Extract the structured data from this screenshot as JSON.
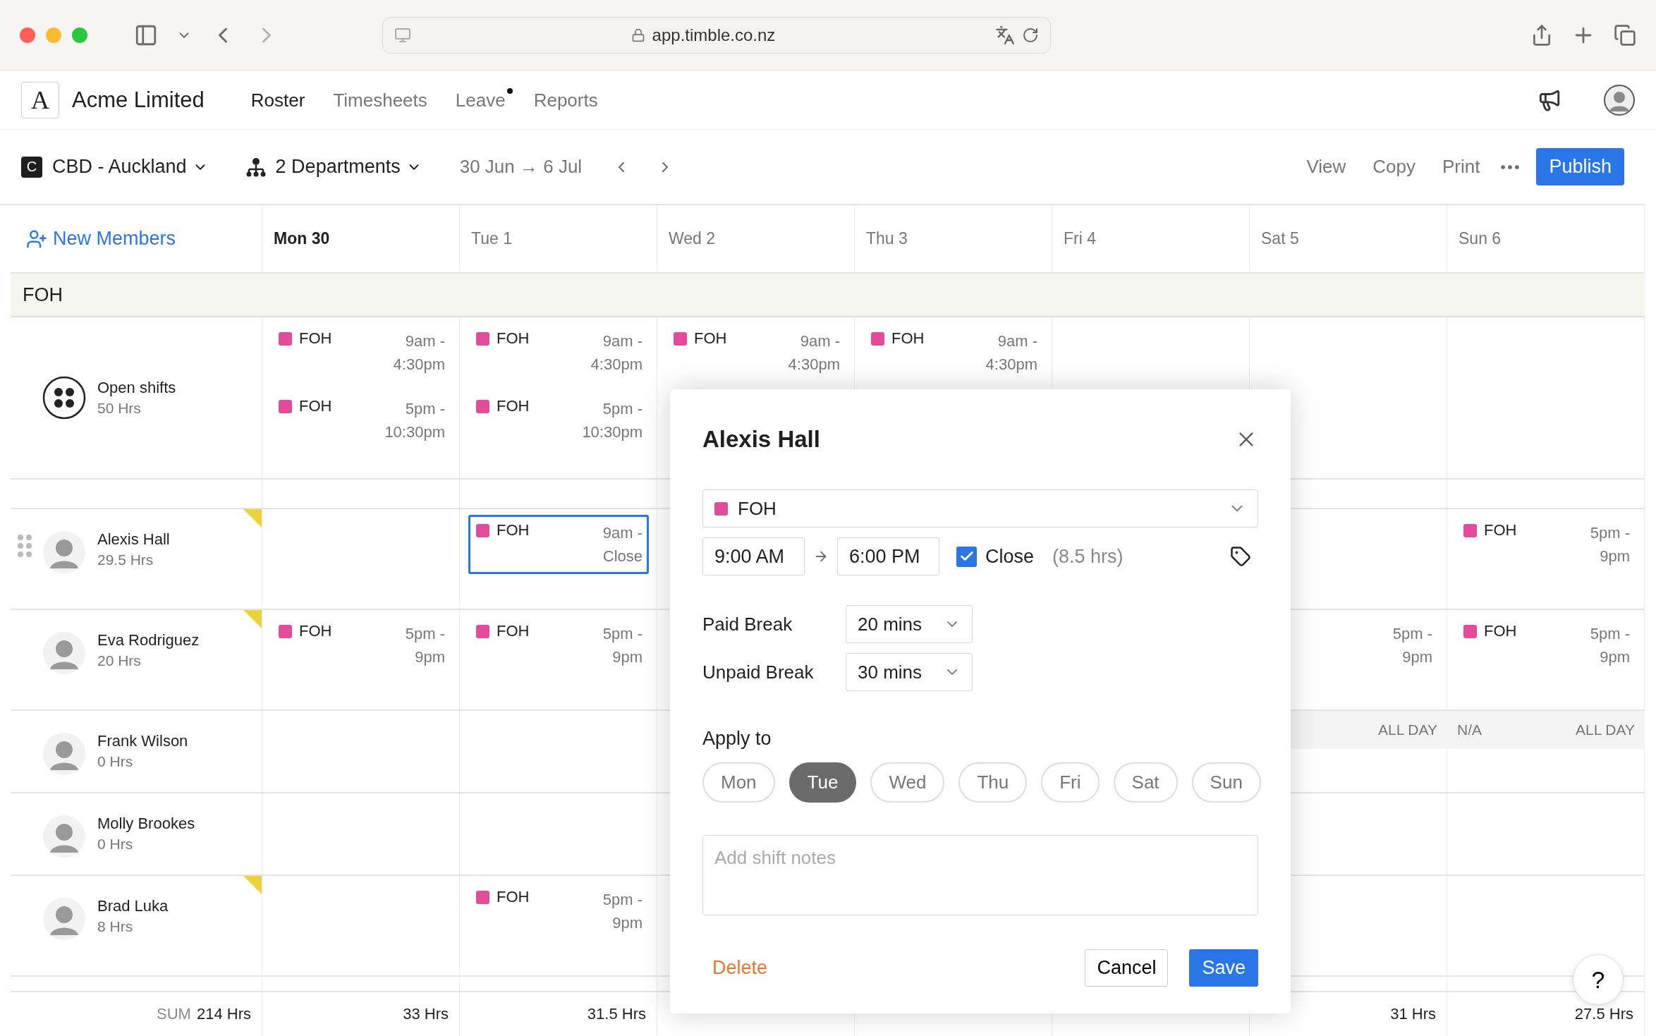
{
  "browser": {
    "url": "app.timble.co.nz"
  },
  "app": {
    "logo": "A",
    "company": "Acme Limited",
    "nav": [
      {
        "label": "Roster",
        "selected": true,
        "dot": false
      },
      {
        "label": "Timesheets",
        "selected": false,
        "dot": false
      },
      {
        "label": "Leave",
        "selected": false,
        "dot": true
      },
      {
        "label": "Reports",
        "selected": false,
        "dot": false
      }
    ]
  },
  "toolbar": {
    "location_badge": "C",
    "location": "CBD - Auckland",
    "departments": "2 Departments",
    "date_range": "30 Jun → 6 Jul",
    "actions": [
      "View",
      "Copy",
      "Print"
    ],
    "publish": "Publish"
  },
  "grid": {
    "new_members": "New Members",
    "group": "FOH",
    "sum_label": "SUM",
    "sum_total": "214 Hrs",
    "days": [
      {
        "label": "Mon 30",
        "today": true,
        "sum": "33 Hrs"
      },
      {
        "label": "Tue 1",
        "today": false,
        "sum": "31.5 Hrs"
      },
      {
        "label": "Wed 2",
        "today": false
      },
      {
        "label": "Thu 3",
        "today": false
      },
      {
        "label": "Fri 4",
        "today": false
      },
      {
        "label": "Sat 5",
        "today": false,
        "sum": "31 Hrs"
      },
      {
        "label": "Sun 6",
        "today": false,
        "sum": "27.5 Hrs"
      }
    ],
    "rows": [
      {
        "kind": "open",
        "name": "Open shifts",
        "hours": "50 Hrs",
        "flagged": false,
        "handle": false,
        "cells": [
          {
            "shifts": [
              {
                "dept": "FOH",
                "time": "9am - 4:30pm",
                "selected": false
              },
              {
                "dept": "FOH",
                "time": "5pm - 10:30pm",
                "selected": false
              }
            ]
          },
          {
            "shifts": [
              {
                "dept": "FOH",
                "time": "9am - 4:30pm",
                "selected": false
              },
              {
                "dept": "FOH",
                "time": "5pm - 10:30pm",
                "selected": false
              }
            ]
          },
          {
            "shifts": [
              {
                "dept": "FOH",
                "time": "9am - 4:30pm",
                "selected": false
              }
            ]
          },
          {
            "shifts": [
              {
                "dept": "FOH",
                "time": "9am - 4:30pm",
                "selected": false
              }
            ]
          },
          {},
          {},
          {}
        ]
      },
      {
        "kind": "person",
        "name": "Alexis Hall",
        "hours": "29.5 Hrs",
        "flagged": true,
        "handle": true,
        "cells": [
          {},
          {
            "shifts": [
              {
                "dept": "FOH",
                "time": "9am - Close",
                "selected": true
              }
            ]
          },
          {},
          {},
          {},
          {},
          {
            "shifts": [
              {
                "dept": "FOH",
                "time": "5pm - 9pm",
                "selected": false
              }
            ]
          }
        ]
      },
      {
        "kind": "person",
        "name": "Eva Rodriguez",
        "hours": "20 Hrs",
        "flagged": true,
        "handle": false,
        "cells": [
          {
            "shifts": [
              {
                "dept": "FOH",
                "time": "5pm - 9pm",
                "selected": false
              }
            ]
          },
          {
            "shifts": [
              {
                "dept": "FOH",
                "time": "5pm - 9pm",
                "selected": false
              }
            ]
          },
          {},
          {},
          {},
          {
            "shifts": [
              {
                "time": "5pm - 9pm",
                "selected": false
              }
            ]
          },
          {
            "shifts": [
              {
                "dept": "FOH",
                "time": "5pm - 9pm",
                "selected": false
              }
            ]
          }
        ]
      },
      {
        "kind": "person",
        "name": "Frank Wilson",
        "hours": "0 Hrs",
        "flagged": false,
        "handle": false,
        "cells": [
          {},
          {},
          {},
          {},
          {},
          {
            "leave": {
              "span": "ALL DAY"
            }
          },
          {
            "leave": {
              "note": "N/A",
              "span": "ALL DAY"
            }
          }
        ]
      },
      {
        "kind": "person",
        "name": "Molly Brookes",
        "hours": "0 Hrs",
        "flagged": false,
        "handle": false,
        "cells": [
          {},
          {},
          {},
          {},
          {},
          {},
          {}
        ]
      },
      {
        "kind": "person",
        "name": "Brad Luka",
        "hours": "8 Hrs",
        "flagged": true,
        "handle": false,
        "cells": [
          {},
          {
            "shifts": [
              {
                "dept": "FOH",
                "time": "5pm - 9pm",
                "selected": false
              }
            ]
          },
          {},
          {},
          {},
          {},
          {}
        ]
      }
    ]
  },
  "modal": {
    "title": "Alexis Hall",
    "dept": "FOH",
    "start": "9:00 AM",
    "end": "6:00 PM",
    "close_checked": true,
    "close_label": "Close",
    "duration": "(8.5 hrs)",
    "breaks": [
      {
        "label": "Paid Break",
        "value": "20 mins"
      },
      {
        "label": "Unpaid Break",
        "value": "30 mins"
      }
    ],
    "apply_label": "Apply to",
    "days": [
      {
        "label": "Mon",
        "selected": false
      },
      {
        "label": "Tue",
        "selected": true
      },
      {
        "label": "Wed",
        "selected": false
      },
      {
        "label": "Thu",
        "selected": false
      },
      {
        "label": "Fri",
        "selected": false
      },
      {
        "label": "Sat",
        "selected": false
      },
      {
        "label": "Sun",
        "selected": false
      }
    ],
    "notes_placeholder": "Add shift notes",
    "delete": "Delete",
    "cancel": "Cancel",
    "save": "Save"
  },
  "help": "?"
}
